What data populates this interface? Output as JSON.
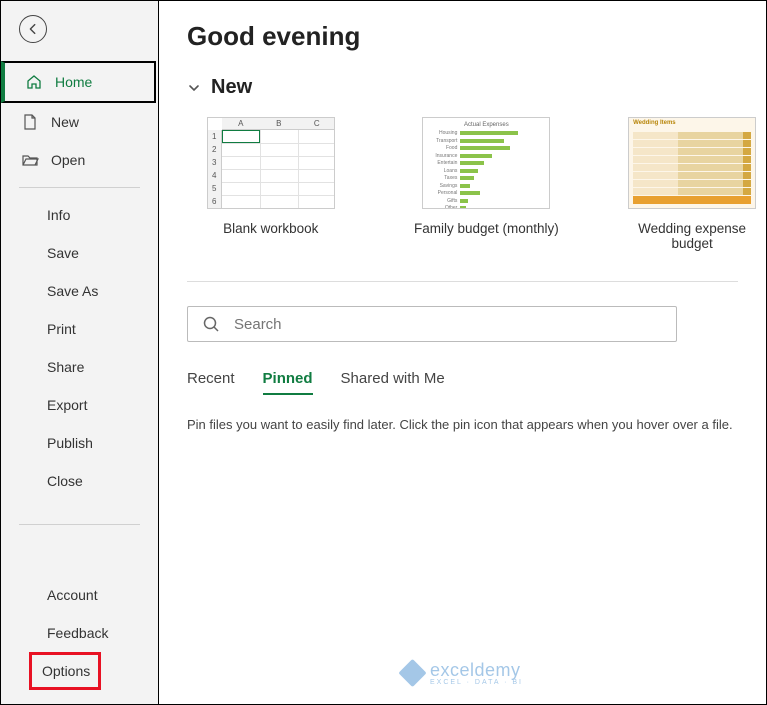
{
  "sidebar": {
    "primary": [
      {
        "label": "Home",
        "icon": "home"
      },
      {
        "label": "New",
        "icon": "document"
      },
      {
        "label": "Open",
        "icon": "folder"
      }
    ],
    "secondary": [
      "Info",
      "Save",
      "Save As",
      "Print",
      "Share",
      "Export",
      "Publish",
      "Close"
    ],
    "footer": [
      "Account",
      "Feedback"
    ],
    "options_label": "Options"
  },
  "main": {
    "greeting": "Good evening",
    "new_section": "New",
    "templates": [
      {
        "label": "Blank workbook"
      },
      {
        "label": "Family budget (monthly)"
      },
      {
        "label": "Wedding expense budget"
      }
    ],
    "search_placeholder": "Search",
    "tabs": [
      "Recent",
      "Pinned",
      "Shared with Me"
    ],
    "active_tab": 1,
    "hint": "Pin files you want to easily find later. Click the pin icon that appears when you hover over a file."
  },
  "watermark": {
    "brand": "exceldemy",
    "tagline": "EXCEL · DATA · BI"
  }
}
